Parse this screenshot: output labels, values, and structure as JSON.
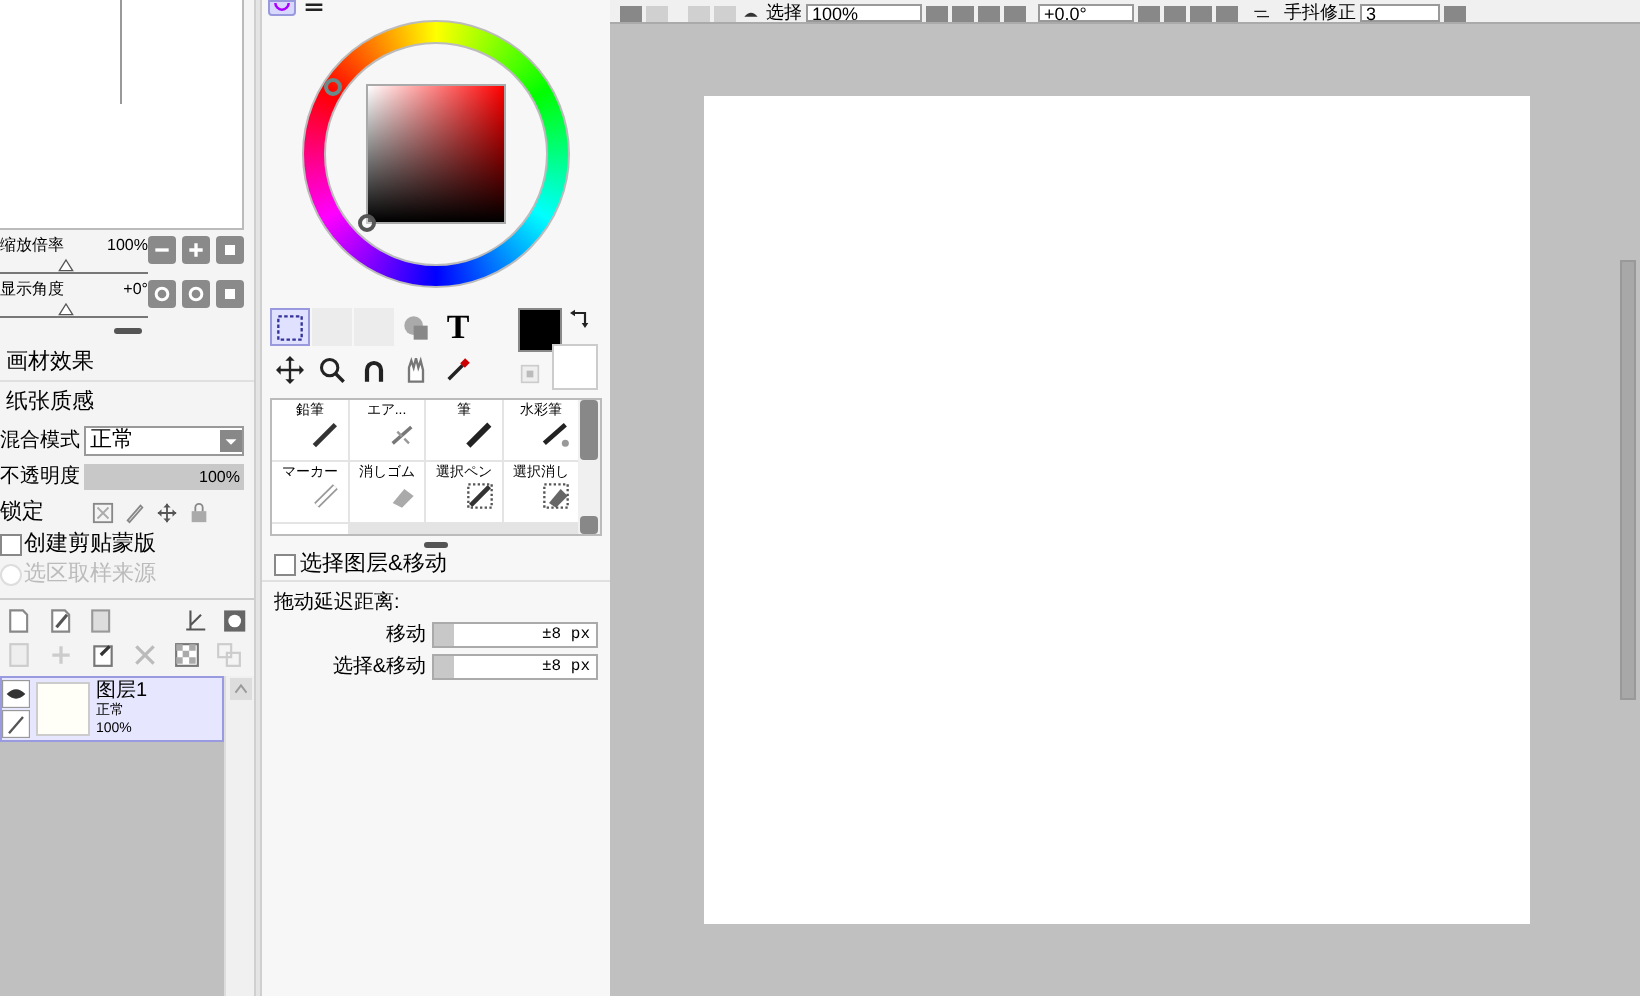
{
  "toolbar": {
    "select_label": "选择",
    "zoom": "100%",
    "angle": "+0.0°",
    "stabilizer_label": "手抖修正",
    "stabilizer": "3"
  },
  "navigator": {
    "zoom_label": "缩放倍率",
    "zoom": "100%",
    "zoom_slider": {
      "level": 0.45
    },
    "angle_label": "显示角度",
    "angle": "+0°",
    "angle_slider": {
      "level": 0.45
    }
  },
  "layer_panel": {
    "texture_label": "画材效果",
    "paper_label": "纸张质感",
    "blend_label": "混合模式",
    "blend": "正常",
    "opacity_label": "不透明度",
    "opacity": "100%",
    "opacity_slider": {
      "level": 1
    },
    "lock_label": "锁定",
    "options": [
      {
        "label": "创建剪贴蒙版",
        "checked": false,
        "disabled": false
      },
      {
        "label": "选区取样来源",
        "checked": false,
        "disabled": true
      }
    ],
    "layers": [
      {
        "name": "图层1",
        "mode": "正常",
        "opacity": "100%",
        "visible": true,
        "selected": true
      }
    ]
  },
  "color_panel": {
    "tabs": [
      {
        "kind": "wheel",
        "selected": true
      },
      {
        "kind": "sliders",
        "selected": false
      }
    ]
  },
  "tools": [
    {
      "kind": "select",
      "selected": true
    },
    {
      "kind": "blank",
      "selected": false
    },
    {
      "kind": "blank",
      "selected": false
    },
    {
      "kind": "bucket",
      "selected": false
    },
    {
      "kind": "text",
      "label": "T",
      "selected": false
    },
    {
      "kind": "move",
      "selected": false
    },
    {
      "kind": "zoom",
      "selected": false
    },
    {
      "kind": "rotate",
      "selected": false
    },
    {
      "kind": "hand",
      "selected": false
    },
    {
      "kind": "picker",
      "selected": false
    }
  ],
  "brushes": [
    {
      "name": "鉛筆",
      "kind": "pencil"
    },
    {
      "name": "エア...",
      "kind": "air"
    },
    {
      "name": "筆",
      "kind": "brush"
    },
    {
      "name": "水彩筆",
      "kind": "water"
    },
    {
      "name": "マーカー",
      "kind": "marker"
    },
    {
      "name": "消しゴム",
      "kind": "eraser"
    },
    {
      "name": "選択ペン",
      "kind": "selpen"
    },
    {
      "name": "選択消し",
      "kind": "selerase"
    }
  ],
  "move_tool": {
    "option": {
      "label": "选择图层&移动",
      "checked": false
    },
    "drag_label": "拖动延迟距离:",
    "sliders": [
      {
        "label": "移动",
        "value": "±8 px",
        "level": 0.12
      },
      {
        "label": "选择&移动",
        "value": "±8 px",
        "level": 0.12
      }
    ]
  }
}
